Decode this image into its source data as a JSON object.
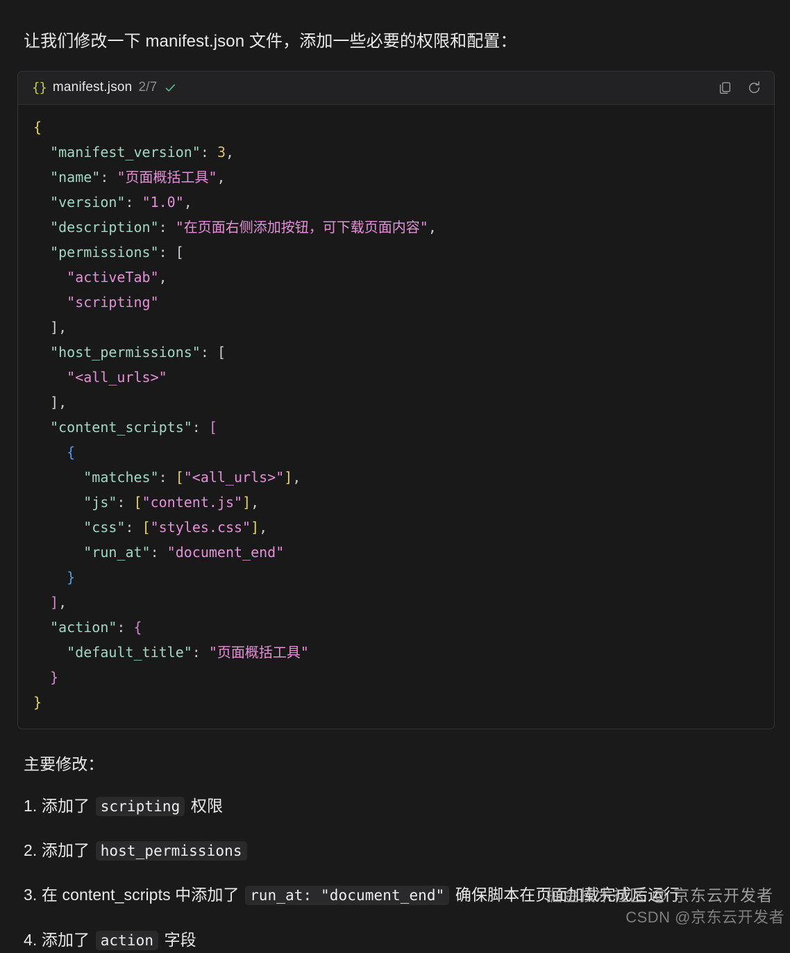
{
  "intro": {
    "text": "让我们修改一下 manifest.json 文件，添加一些必要的权限和配置："
  },
  "code_block": {
    "lang_icon": "{}",
    "filename": "manifest.json",
    "count": "2/7",
    "status_icon": "check-icon",
    "actions": [
      {
        "name": "copy-icon",
        "label": "copy"
      },
      {
        "name": "refresh-icon",
        "label": "refresh"
      }
    ],
    "language": "json",
    "colors": {
      "page_bg": "#1a1a1a",
      "block_bg": "#191919",
      "header_bg": "#222224",
      "border": "#333336",
      "key": "#9fd9c2",
      "string": "#e58fd8",
      "number": "#d6c177",
      "bracket_depth1": "#e8d44d",
      "bracket_depth2": "#d982d5",
      "bracket_depth3": "#4c9ae8",
      "punctuation": "#c9c9cf",
      "json_glyph": "#c3c94e",
      "check": "#5bbf8e"
    },
    "lines": [
      {
        "indent": 0,
        "tokens": [
          {
            "t": "{",
            "c": "b1"
          }
        ]
      },
      {
        "indent": 1,
        "tokens": [
          {
            "t": "\"manifest_version\"",
            "c": "k"
          },
          {
            "t": ": ",
            "c": "p"
          },
          {
            "t": "3",
            "c": "n"
          },
          {
            "t": ",",
            "c": "p"
          }
        ]
      },
      {
        "indent": 1,
        "tokens": [
          {
            "t": "\"name\"",
            "c": "k"
          },
          {
            "t": ": ",
            "c": "p"
          },
          {
            "t": "\"页面概括工具\"",
            "c": "s"
          },
          {
            "t": ",",
            "c": "p"
          }
        ]
      },
      {
        "indent": 1,
        "tokens": [
          {
            "t": "\"version\"",
            "c": "k"
          },
          {
            "t": ": ",
            "c": "p"
          },
          {
            "t": "\"1.0\"",
            "c": "s"
          },
          {
            "t": ",",
            "c": "p"
          }
        ]
      },
      {
        "indent": 1,
        "tokens": [
          {
            "t": "\"description\"",
            "c": "k"
          },
          {
            "t": ": ",
            "c": "p"
          },
          {
            "t": "\"在页面右侧添加按钮，可下载页面内容\"",
            "c": "s"
          },
          {
            "t": ",",
            "c": "p"
          }
        ]
      },
      {
        "indent": 1,
        "tokens": [
          {
            "t": "\"permissions\"",
            "c": "k"
          },
          {
            "t": ": ",
            "c": "p"
          },
          {
            "t": "[",
            "c": "bw"
          }
        ]
      },
      {
        "indent": 2,
        "tokens": [
          {
            "t": "\"activeTab\"",
            "c": "s"
          },
          {
            "t": ",",
            "c": "p"
          }
        ]
      },
      {
        "indent": 2,
        "tokens": [
          {
            "t": "\"scripting\"",
            "c": "s"
          }
        ]
      },
      {
        "indent": 1,
        "tokens": [
          {
            "t": "]",
            "c": "bw"
          },
          {
            "t": ",",
            "c": "p"
          }
        ]
      },
      {
        "indent": 1,
        "tokens": [
          {
            "t": "\"host_permissions\"",
            "c": "k"
          },
          {
            "t": ": ",
            "c": "p"
          },
          {
            "t": "[",
            "c": "bw"
          }
        ]
      },
      {
        "indent": 2,
        "tokens": [
          {
            "t": "\"<all_urls>\"",
            "c": "s"
          }
        ]
      },
      {
        "indent": 1,
        "tokens": [
          {
            "t": "]",
            "c": "bw"
          },
          {
            "t": ",",
            "c": "p"
          }
        ]
      },
      {
        "indent": 1,
        "tokens": [
          {
            "t": "\"content_scripts\"",
            "c": "k"
          },
          {
            "t": ": ",
            "c": "p"
          },
          {
            "t": "[",
            "c": "b2"
          }
        ]
      },
      {
        "indent": 2,
        "tokens": [
          {
            "t": "{",
            "c": "b3"
          }
        ]
      },
      {
        "indent": 3,
        "tokens": [
          {
            "t": "\"matches\"",
            "c": "k"
          },
          {
            "t": ": ",
            "c": "p"
          },
          {
            "t": "[",
            "c": "b1"
          },
          {
            "t": "\"<all_urls>\"",
            "c": "s"
          },
          {
            "t": "]",
            "c": "b1"
          },
          {
            "t": ",",
            "c": "p"
          }
        ]
      },
      {
        "indent": 3,
        "tokens": [
          {
            "t": "\"js\"",
            "c": "k"
          },
          {
            "t": ": ",
            "c": "p"
          },
          {
            "t": "[",
            "c": "b1"
          },
          {
            "t": "\"content.js\"",
            "c": "s"
          },
          {
            "t": "]",
            "c": "b1"
          },
          {
            "t": ",",
            "c": "p"
          }
        ]
      },
      {
        "indent": 3,
        "tokens": [
          {
            "t": "\"css\"",
            "c": "k"
          },
          {
            "t": ": ",
            "c": "p"
          },
          {
            "t": "[",
            "c": "b1"
          },
          {
            "t": "\"styles.css\"",
            "c": "s"
          },
          {
            "t": "]",
            "c": "b1"
          },
          {
            "t": ",",
            "c": "p"
          }
        ]
      },
      {
        "indent": 3,
        "tokens": [
          {
            "t": "\"run_at\"",
            "c": "k"
          },
          {
            "t": ": ",
            "c": "p"
          },
          {
            "t": "\"document_end\"",
            "c": "s"
          }
        ]
      },
      {
        "indent": 2,
        "tokens": [
          {
            "t": "}",
            "c": "b3"
          }
        ]
      },
      {
        "indent": 1,
        "tokens": [
          {
            "t": "]",
            "c": "b2"
          },
          {
            "t": ",",
            "c": "p"
          }
        ]
      },
      {
        "indent": 1,
        "tokens": [
          {
            "t": "\"action\"",
            "c": "k"
          },
          {
            "t": ": ",
            "c": "p"
          },
          {
            "t": "{",
            "c": "b2"
          }
        ]
      },
      {
        "indent": 2,
        "tokens": [
          {
            "t": "\"default_title\"",
            "c": "k"
          },
          {
            "t": ": ",
            "c": "p"
          },
          {
            "t": "\"页面概括工具\"",
            "c": "s"
          }
        ]
      },
      {
        "indent": 1,
        "tokens": [
          {
            "t": "}",
            "c": "b2"
          }
        ]
      },
      {
        "indent": 0,
        "tokens": [
          {
            "t": "}",
            "c": "b1"
          }
        ]
      }
    ]
  },
  "summary": {
    "heading": "主要修改：",
    "items": [
      [
        {
          "type": "text",
          "text": "添加了 "
        },
        {
          "type": "code",
          "text": "scripting"
        },
        {
          "type": "text",
          "text": " 权限"
        }
      ],
      [
        {
          "type": "text",
          "text": "添加了 "
        },
        {
          "type": "code",
          "text": "host_permissions"
        }
      ],
      [
        {
          "type": "text",
          "text": "在 content_scripts 中添加了 "
        },
        {
          "type": "code",
          "text": "run_at: \"document_end\""
        },
        {
          "type": "text",
          "text": " 确保脚本在页面加载完成后运行"
        }
      ],
      [
        {
          "type": "text",
          "text": "添加了 "
        },
        {
          "type": "code",
          "text": "action"
        },
        {
          "type": "text",
          "text": " 字段"
        }
      ]
    ]
  },
  "watermarks": {
    "juejin": "掘金技术社区 @ 京东云开发者",
    "csdn": "CSDN @京东云开发者"
  }
}
